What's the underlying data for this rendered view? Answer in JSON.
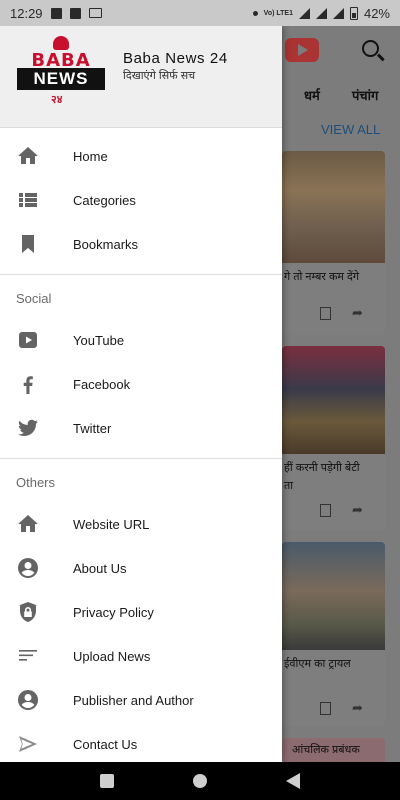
{
  "status_bar": {
    "time": "12:29",
    "volte": "Vo) LTE1",
    "battery": "42%"
  },
  "brand": {
    "logo_top": "BABA",
    "logo_bottom": "NEWS",
    "logo_number": "२४",
    "name": "Baba News 24",
    "tagline": "दिखाएंगे सिर्फ सच"
  },
  "menu": {
    "main": [
      {
        "label": "Home",
        "icon": "home-icon"
      },
      {
        "label": "Categories",
        "icon": "list-icon"
      },
      {
        "label": "Bookmarks",
        "icon": "bookmark-icon"
      }
    ],
    "social": {
      "title": "Social",
      "items": [
        {
          "label": "YouTube",
          "icon": "youtube-icon"
        },
        {
          "label": "Facebook",
          "icon": "facebook-icon"
        },
        {
          "label": "Twitter",
          "icon": "twitter-icon"
        }
      ]
    },
    "others": {
      "title": "Others",
      "items": [
        {
          "label": "Website URL",
          "icon": "home-icon"
        },
        {
          "label": "About Us",
          "icon": "person-icon"
        },
        {
          "label": "Privacy Policy",
          "icon": "shield-lock-icon"
        },
        {
          "label": "Upload News",
          "icon": "lines-icon"
        },
        {
          "label": "Publisher and Author",
          "icon": "person-icon"
        },
        {
          "label": "Contact Us",
          "icon": "send-icon"
        }
      ]
    }
  },
  "background": {
    "categories": [
      "धर्म",
      "पंचांग"
    ],
    "view_all": "VIEW ALL",
    "cards": [
      {
        "headline": "गे तो नम्बर कम देंगे"
      },
      {
        "headline_line1": "हीं करनी पड़ेगी बेटी",
        "headline_line2": "ता"
      },
      {
        "headline": "ईवीएम का ट्रायल"
      },
      {
        "headline": "आंचलिक प्रबंधक"
      }
    ]
  }
}
